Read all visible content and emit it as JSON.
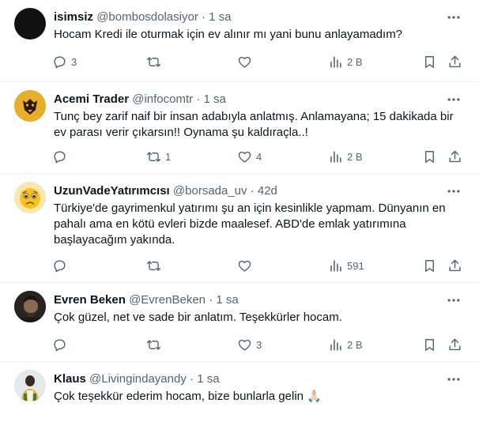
{
  "posts": [
    {
      "name": "isimsiz",
      "handle": "@bombosdolasiyor",
      "sep": "·",
      "time": "1 sa",
      "text": "Hocam Kredi ile oturmak için ev alınır mı yani bunu anlayamadım?",
      "replies": "3",
      "reposts": "",
      "likes": "",
      "views": "2 B"
    },
    {
      "name": "Acemi Trader",
      "handle": "@infocomtr",
      "sep": "·",
      "time": "1 sa",
      "text": "Tunç bey zarif naif bir insan adabıyla anlatmış. Anlamayana; 15 dakikada bir ev parası verir çıkarsın!! Oynama şu kaldıraçla..!",
      "replies": "",
      "reposts": "1",
      "likes": "4",
      "views": "2 B"
    },
    {
      "name": "UzunVadeYatırımcısı",
      "handle": "@borsada_uv",
      "sep": "·",
      "time": "42d",
      "text": "Türkiye'de gayrimenkul yatırımı şu an için kesinlikle yapmam. Dünyanın en pahalı ama en kötü evleri bizde maalesef. ABD'de emlak yatırımına başlayacağım yakında.",
      "replies": "",
      "reposts": "",
      "likes": "",
      "views": "591"
    },
    {
      "name": "Evren Beken",
      "handle": "@EvrenBeken",
      "sep": "·",
      "time": "1 sa",
      "text": "Çok güzel, net ve sade bir anlatım. Teşekkürler hocam.",
      "replies": "",
      "reposts": "",
      "likes": "3",
      "views": "2 B"
    },
    {
      "name": "Klaus",
      "handle": "@Livingindayandy",
      "sep": "·",
      "time": "1 sa",
      "text": "Çok teşekkür ederim hocam, bize bunlarla gelin 🙏🏻"
    }
  ],
  "icons": {
    "reply": "reply-icon",
    "repost": "repost-icon",
    "like": "heart-icon",
    "views": "views-icon",
    "bookmark": "bookmark-icon",
    "share": "share-icon",
    "more": "more-icon"
  },
  "colors": {
    "text": "#0f1419",
    "muted": "#536471",
    "divider": "#eff3f4"
  }
}
